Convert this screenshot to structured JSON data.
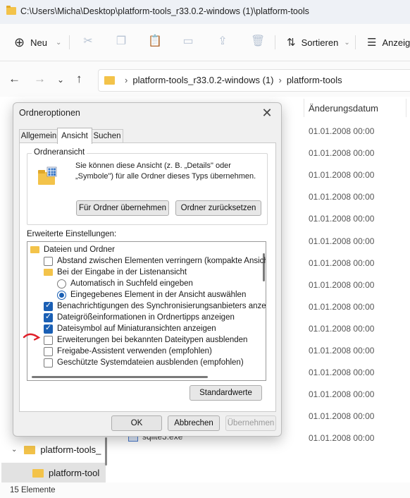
{
  "window": {
    "title": "C:\\Users\\Micha\\Desktop\\platform-tools_r33.0.2-windows (1)\\platform-tools"
  },
  "toolbar": {
    "new_label": "Neu",
    "sort_label": "Sortieren",
    "view_label": "Anzeig"
  },
  "address": {
    "crumb1": "platform-tools_r33.0.2-windows (1)",
    "crumb2": "platform-tools"
  },
  "columns": {
    "date_header": "Änderungsdatum"
  },
  "dates": [
    "01.01.2008 00:00",
    "01.01.2008 00:00",
    "01.01.2008 00:00",
    "01.01.2008 00:00",
    "01.01.2008 00:00",
    "01.01.2008 00:00",
    "01.01.2008 00:00",
    "01.01.2008 00:00",
    "01.01.2008 00:00",
    "01.01.2008 00:00",
    "01.01.2008 00:00",
    "01.01.2008 00:00",
    "01.01.2008 00:00",
    "01.01.2008 00:00",
    "01.01.2008 00:00"
  ],
  "file_visible": "sqlite3.exe",
  "tree": {
    "item1": "platform-tools_",
    "item2": "platform-tool"
  },
  "status": {
    "count": "15 Elemente"
  },
  "dialog": {
    "title": "Ordneroptionen",
    "tabs": [
      "Allgemein",
      "Ansicht",
      "Suchen"
    ],
    "group_title": "Ordneransicht",
    "group_text": "Sie können diese Ansicht (z. B. „Details\" oder „Symbole\") für alle Ordner dieses Typs übernehmen.",
    "apply_button": "Für Ordner übernehmen",
    "reset_button": "Ordner zurücksetzen",
    "advanced_label": "Erweiterte Einstellungen:",
    "settings": [
      {
        "label": "Dateien und Ordner",
        "kind": "folder",
        "checked": false,
        "level": 0
      },
      {
        "label": "Abstand zwischen Elementen verringern (kompakte Ansicht)",
        "kind": "checkbox",
        "checked": false,
        "level": 1
      },
      {
        "label": "Bei der Eingabe in der Listenansicht",
        "kind": "folder",
        "checked": false,
        "level": 1
      },
      {
        "label": "Automatisch in Suchfeld eingeben",
        "kind": "radio",
        "checked": false,
        "level": 2
      },
      {
        "label": "Eingegebenes Element in der Ansicht auswählen",
        "kind": "radio",
        "checked": true,
        "level": 2
      },
      {
        "label": "Benachrichtigungen des Synchronisierungsanbieters anzeigen",
        "kind": "checkbox",
        "checked": true,
        "level": 1
      },
      {
        "label": "Dateigrößeinformationen in Ordnertipps anzeigen",
        "kind": "checkbox",
        "checked": true,
        "level": 1
      },
      {
        "label": "Dateisymbol auf Miniaturansichten anzeigen",
        "kind": "checkbox",
        "checked": true,
        "level": 1
      },
      {
        "label": "Erweiterungen bei bekannten Dateitypen ausblenden",
        "kind": "checkbox",
        "checked": false,
        "level": 1
      },
      {
        "label": "Freigabe-Assistent verwenden (empfohlen)",
        "kind": "checkbox",
        "checked": false,
        "level": 1
      },
      {
        "label": "Geschützte Systemdateien ausblenden (empfohlen)",
        "kind": "checkbox",
        "checked": false,
        "level": 1
      }
    ],
    "defaults_button": "Standardwerte",
    "ok_button": "OK",
    "cancel_button": "Abbrechen",
    "apply_disabled_button": "Übernehmen"
  },
  "colors": {
    "accent": "#1a5fb4",
    "folder": "#f3c34a",
    "annotation": "#e0202a"
  }
}
